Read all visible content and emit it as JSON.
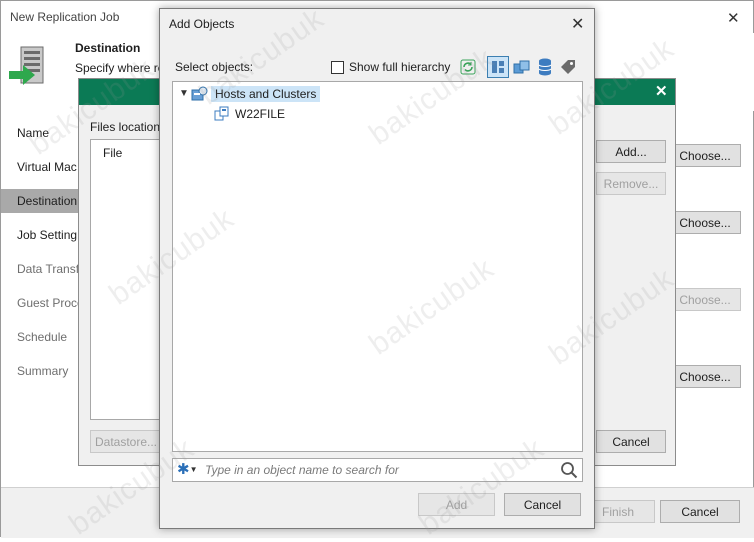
{
  "wizard": {
    "title": "New Replication Job",
    "header_title": "Destination",
    "header_subtitle": "Specify where re",
    "nav": [
      "Name",
      "Virtual Mac",
      "Destination",
      "Job Setting",
      "Data Transf",
      "Guest Proce",
      "Schedule",
      "Summary"
    ],
    "choose_label": "Choose...",
    "finish_label": "Finish",
    "cancel_label": "Cancel"
  },
  "middle_dialog": {
    "files_location_label": "Files location",
    "file_column": "File",
    "add_label": "Add...",
    "remove_label": "Remove...",
    "datastore_label": "Datastore...",
    "cancel_label": "Cancel"
  },
  "add_objects": {
    "title": "Add Objects",
    "select_objects_label": "Select objects:",
    "show_full_hierarchy_label": "Show full hierarchy",
    "show_full_hierarchy_checked": false,
    "tree": [
      {
        "label": "Hosts and Clusters",
        "expanded": true,
        "selected": true
      },
      {
        "label": "W22FILE",
        "selected": false
      }
    ],
    "search_placeholder": "Type in an object name to search for",
    "add_label": "Add",
    "cancel_label": "Cancel"
  },
  "watermark": "bakicubuk",
  "colors": {
    "accent_green": "#0b7a55",
    "selection": "#cce4f7",
    "focus_blue": "#0078d7"
  }
}
